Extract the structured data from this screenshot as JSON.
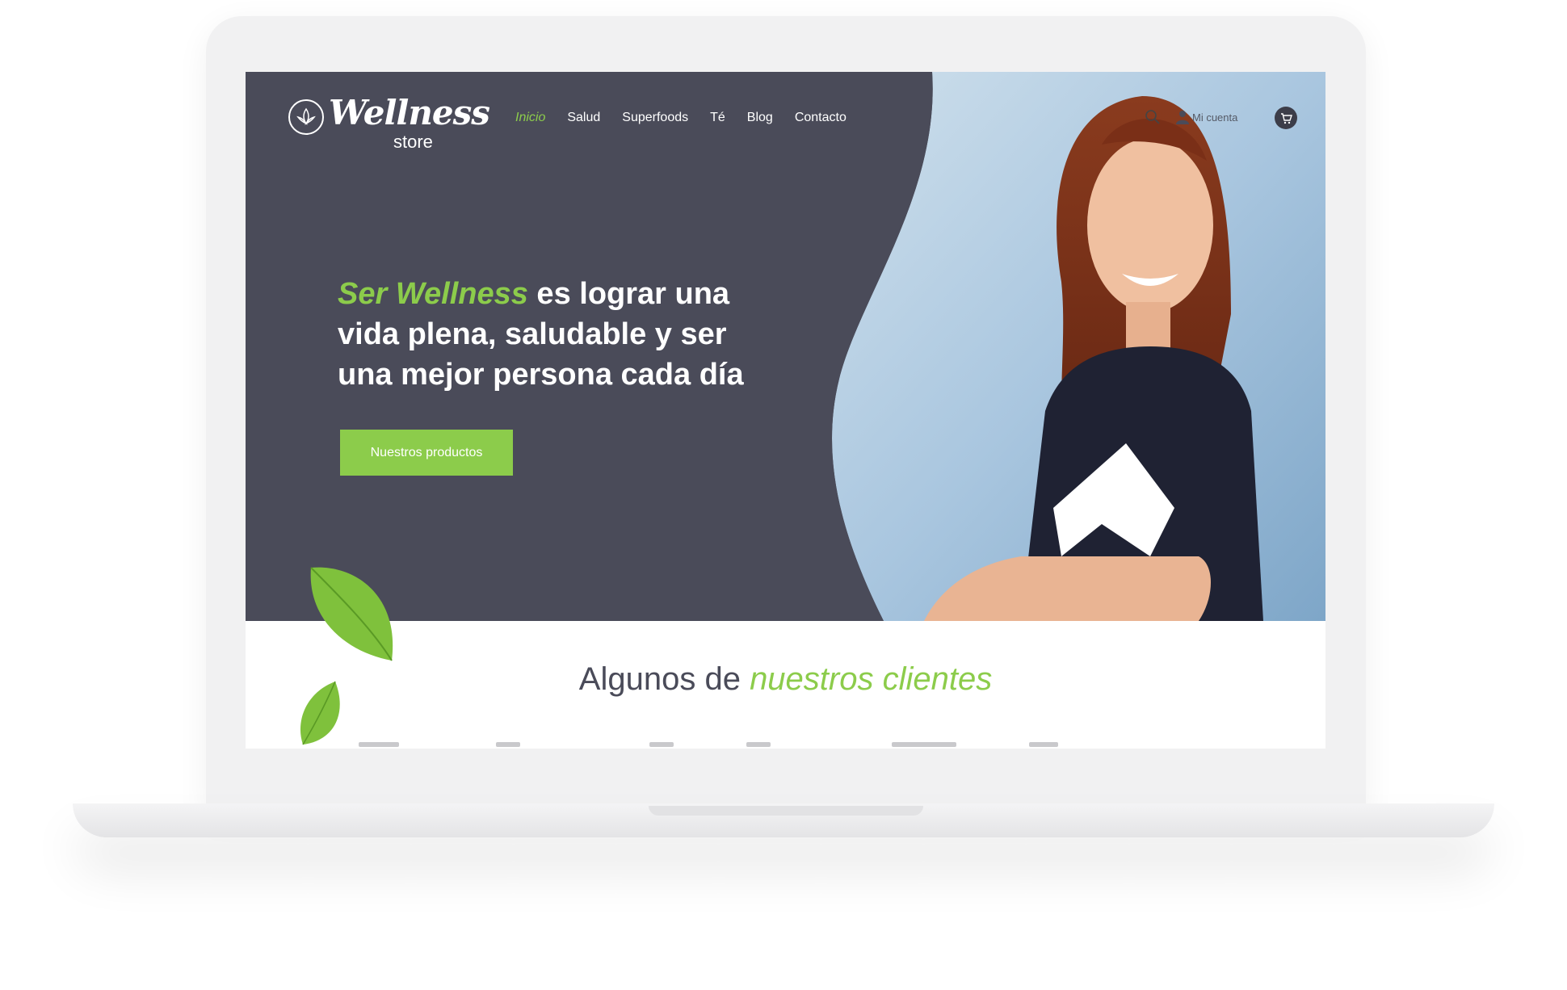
{
  "brand": {
    "name": "Wellness",
    "sub": "store"
  },
  "nav": {
    "items": [
      {
        "label": "Inicio",
        "active": true
      },
      {
        "label": "Salud",
        "active": false
      },
      {
        "label": "Superfoods",
        "active": false
      },
      {
        "label": "Té",
        "active": false
      },
      {
        "label": "Blog",
        "active": false
      },
      {
        "label": "Contacto",
        "active": false
      }
    ],
    "account_label": "Mi cuenta",
    "search_icon": "search-icon",
    "cart_icon": "cart-icon"
  },
  "hero": {
    "headline_accent": "Ser Wellness",
    "headline_rest": " es lograr una vida plena, saludable y ser una mejor persona cada día",
    "cta_label": "Nuestros productos"
  },
  "clients": {
    "title_plain": "Algunos de ",
    "title_accent": "nuestros clientes"
  },
  "colors": {
    "accent": "#8ccc4b",
    "hero_bg": "#4a4b59",
    "white": "#ffffff"
  }
}
